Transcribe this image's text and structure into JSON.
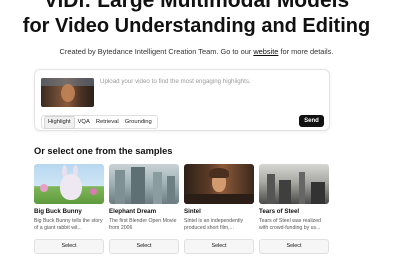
{
  "header": {
    "title_line1": "ViDi: Large Multimodal Models",
    "title_line2": "for Video Understanding and Editing",
    "subtitle_prefix": "Created by Bytedance Intelligent Creation Team. Go to our ",
    "subtitle_link": "website",
    "subtitle_suffix": " for more details."
  },
  "upload": {
    "placeholder": "Upload your video to find the most engaging highlights.",
    "modes": [
      "Highlight",
      "VQA",
      "Retrieval",
      "Grounding"
    ],
    "active_mode": "Highlight",
    "send_label": "Send"
  },
  "samples": {
    "heading": "Or select one from the samples",
    "items": [
      {
        "name": "Big Buck Bunny",
        "desc": "Big Buck Bunny tells the story of a giant rabbit wit...",
        "select": "Select"
      },
      {
        "name": "Elephant Dream",
        "desc": "The first Blender Open Movie from 2006",
        "select": "Select"
      },
      {
        "name": "Sintel",
        "desc": "Sintel is an independently produced short film,...",
        "select": "Select"
      },
      {
        "name": "Tears of Steel",
        "desc": "Tears of Steel was realized with crowd-funding by us...",
        "select": "Select"
      }
    ]
  }
}
